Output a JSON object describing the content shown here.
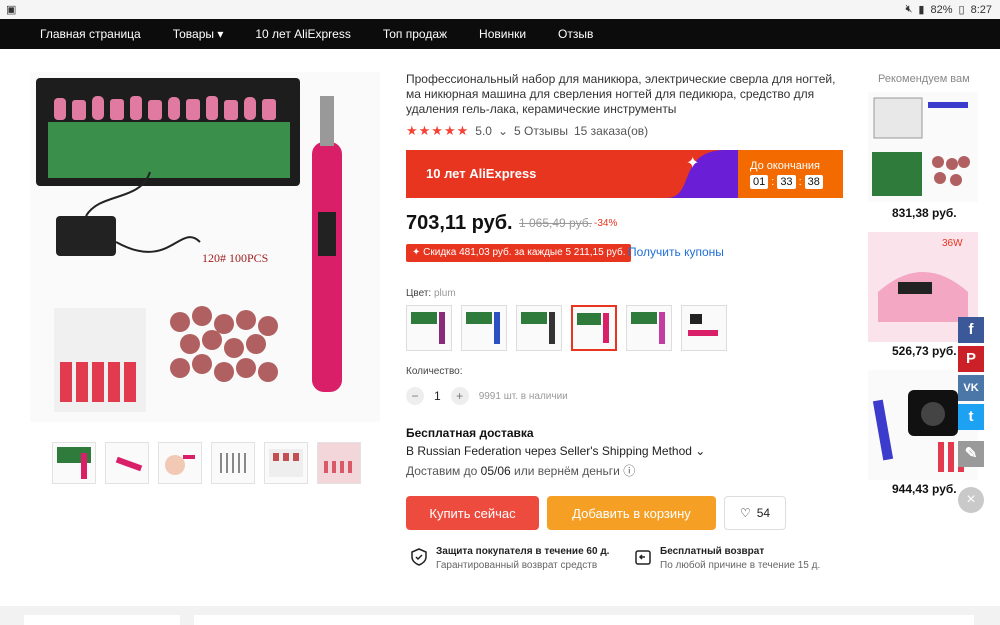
{
  "status_bar": {
    "battery": "82%",
    "time": "8:27"
  },
  "nav": {
    "items": [
      "Главная страница",
      "Товары",
      "10 лет AliExpress",
      "Топ продаж",
      "Новинки",
      "Отзыв"
    ]
  },
  "product": {
    "title": "Профессиональный набор для маникюра, электрические сверла для ногтей, ма никюрная машина для сверления ногтей для педикюра, средство для удаления гель-лака, керамические инструменты",
    "gallery_caption": "120# 100PCS",
    "rating": "5.0",
    "reviews": "5 Отзывы",
    "orders": "15 заказа(ов)",
    "promo_label": "10 лет AliExpress",
    "promo_timer_label": "До окончания",
    "timer": [
      "01",
      "33",
      "38"
    ],
    "price": "703,11 руб.",
    "old_price": "1 065,49 руб.",
    "discount": "-34%",
    "coupon": "✦ Скидка 481,03 руб. за каждые 5 211,15 руб.",
    "get_coupons": "Получить купоны",
    "color_label": "Цвет:",
    "color_value": "plum",
    "quantity_label": "Количество:",
    "quantity": "1",
    "stock": "9991 шт. в наличии",
    "shipping_title": "Бесплатная доставка",
    "shipping_line": "В Russian Federation через Seller's Shipping Method",
    "delivery_prefix": "Доставим до ",
    "delivery_date": "05/06",
    "delivery_suffix": " или вернём деньги",
    "buy_now": "Купить сейчас",
    "add_to_cart": "Добавить в корзину",
    "wishlist_count": "54",
    "guarantee1_title": "Защита покупателя в течение 60 д.",
    "guarantee1_sub": "Гарантированный возврат средств",
    "guarantee2_title": "Бесплатный возврат",
    "guarantee2_sub": "По любой причине в течение 15 д."
  },
  "recommend": {
    "title": "Рекомендуем вам",
    "items": [
      {
        "price": "831,38 руб."
      },
      {
        "price": "526,73 руб.",
        "badge": "36W"
      },
      {
        "price": "944,43 руб."
      }
    ]
  },
  "social": [
    "f",
    "P",
    "VK",
    "t",
    "✎"
  ],
  "colors": {
    "nav_bg": "#0c0c0c",
    "accent_red": "#e8351f",
    "accent_orange": "#f5a025",
    "promo_purple": "#6a1fd6",
    "facebook": "#3b5998",
    "pinterest": "#cb2027",
    "vk": "#4a76a8",
    "twitter": "#1da1f2"
  }
}
